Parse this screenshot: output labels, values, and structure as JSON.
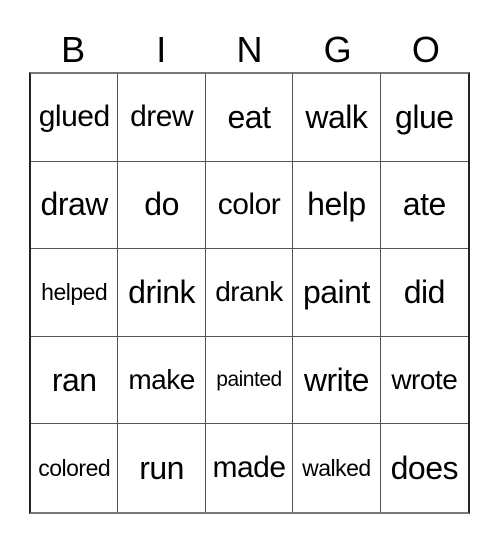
{
  "header": [
    "B",
    "I",
    "N",
    "G",
    "O"
  ],
  "cells": [
    [
      "glued",
      "drew",
      "eat",
      "walk",
      "glue"
    ],
    [
      "draw",
      "do",
      "color",
      "help",
      "ate"
    ],
    [
      "helped",
      "drink",
      "drank",
      "paint",
      "did"
    ],
    [
      "ran",
      "make",
      "painted",
      "write",
      "wrote"
    ],
    [
      "colored",
      "run",
      "made",
      "walked",
      "does"
    ]
  ]
}
